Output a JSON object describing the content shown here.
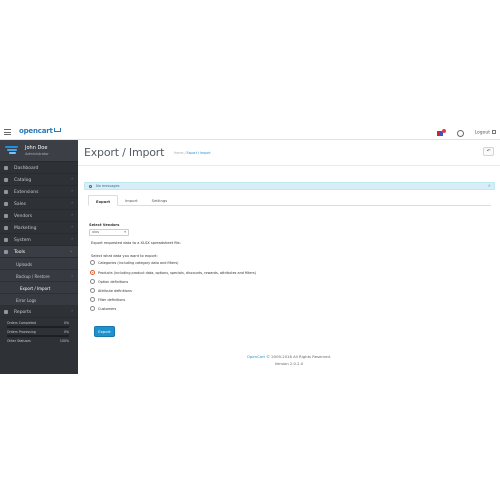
{
  "header": {
    "logo_text": "opencart",
    "logout_label": "Logout"
  },
  "sidebar": {
    "user_name": "John Doe",
    "user_role": "Administrator",
    "items": [
      {
        "label": "Dashboard",
        "icon": "dashboard-icon",
        "arrow": ""
      },
      {
        "label": "Catalog",
        "icon": "tag-icon",
        "arrow": "›"
      },
      {
        "label": "Extensions",
        "icon": "puzzle-icon",
        "arrow": "›"
      },
      {
        "label": "Sales",
        "icon": "cart-icon",
        "arrow": "›"
      },
      {
        "label": "Vendors",
        "icon": "users-icon",
        "arrow": "›"
      },
      {
        "label": "Marketing",
        "icon": "share-icon",
        "arrow": "›"
      },
      {
        "label": "System",
        "icon": "cog-icon",
        "arrow": "›"
      },
      {
        "label": "Tools",
        "icon": "wrench-icon",
        "arrow": "⌄"
      }
    ],
    "tools_sub": [
      {
        "label": "Uploads"
      },
      {
        "label": "Backup / Restore"
      },
      {
        "label": "Export / Import"
      },
      {
        "label": "Error Logs"
      }
    ],
    "reports_label": "Reports",
    "stats": [
      {
        "label": "Orders Completed",
        "value": "0%",
        "fraction": 0
      },
      {
        "label": "Orders Processing",
        "value": "0%",
        "fraction": 0
      },
      {
        "label": "Other Statuses",
        "value": "100%",
        "fraction": 1
      }
    ]
  },
  "main": {
    "title": "Export / Import",
    "breadcrumb_home": "Home",
    "breadcrumb_sep": "/",
    "breadcrumb_current": "Export / Import",
    "alert_text": "No messages",
    "alert_close": "×",
    "tabs": [
      {
        "label": "Export"
      },
      {
        "label": "Import"
      },
      {
        "label": "Settings"
      }
    ],
    "select_label": "Select Vendors",
    "select_value": "xlxs",
    "export_note": "Export requested data to a XLSX spreadsheet file.",
    "data_question": "Select what data you want to export:",
    "options": [
      {
        "label": "Categories (including category data and filters)",
        "checked": false
      },
      {
        "label": "Products (including product data, options, specials, discounts, rewards, attributes and filters)",
        "checked": true
      },
      {
        "label": "Option definitions",
        "checked": false
      },
      {
        "label": "Attribute definitions",
        "checked": false
      },
      {
        "label": "Filter definitions",
        "checked": false
      },
      {
        "label": "Customers",
        "checked": false
      }
    ],
    "export_button": "Export"
  },
  "footer": {
    "link": "OpenCart",
    "copyright": " © 2009-2016 All Rights Reserved.",
    "version": "Version 2.0.2.0"
  },
  "colors": {
    "accent": "#1e91cf",
    "sidebar_bg": "#2e3237",
    "alert_bg": "#d9edf7"
  }
}
